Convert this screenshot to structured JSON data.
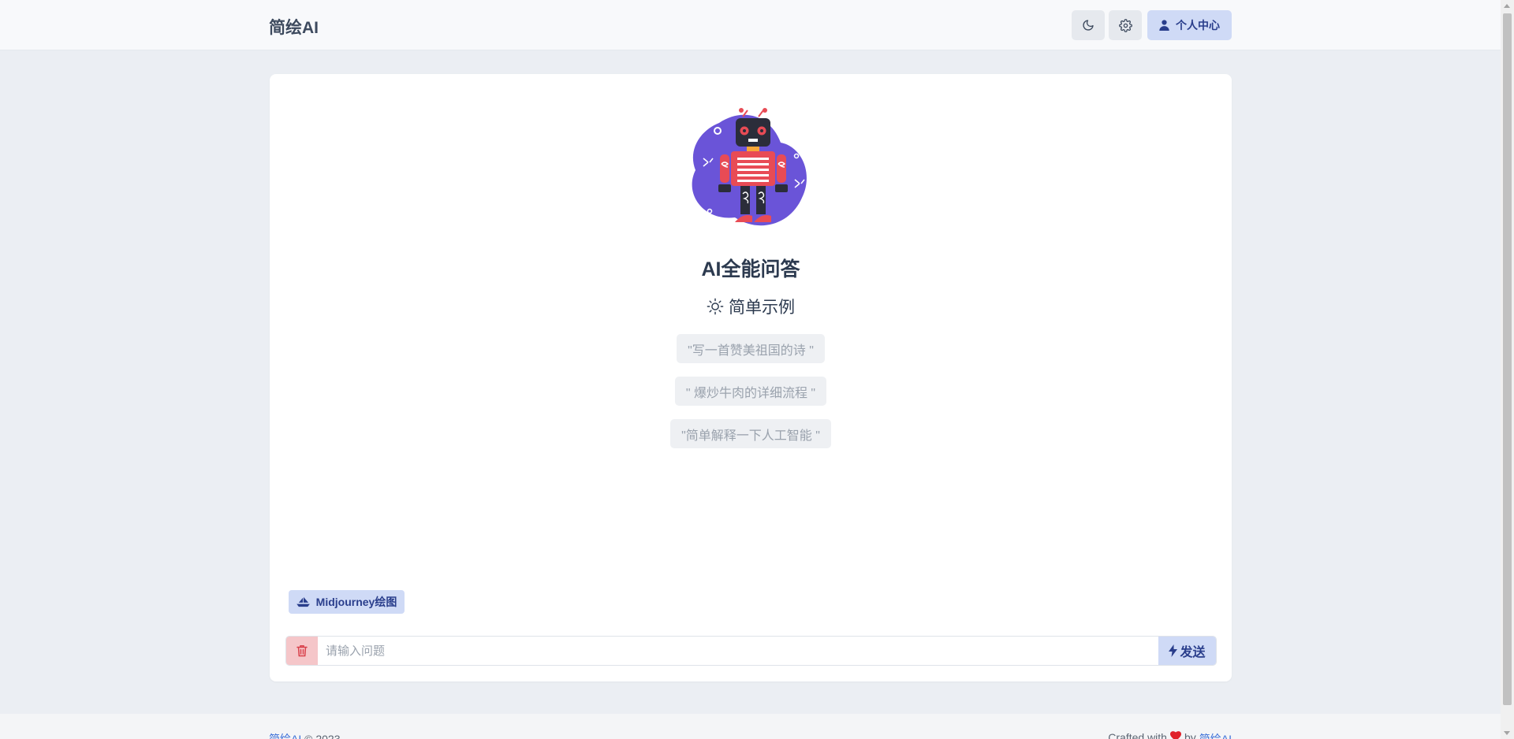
{
  "header": {
    "brand": "简绘AI",
    "user_center_label": "个人中心",
    "icons": {
      "theme": "moon-icon",
      "settings": "gear-icon",
      "user": "user-icon"
    }
  },
  "main": {
    "title": "AI全能问答",
    "examples_heading": "简单示例",
    "examples": [
      "\"写一首赞美祖国的诗 \"",
      "\" 爆炒牛肉的详细流程 \"",
      "\"简单解释一下人工智能 \""
    ],
    "midjourney_button": "Midjourney绘图",
    "input": {
      "placeholder": "请输入问题",
      "value": ""
    },
    "send_button": "发送"
  },
  "footer": {
    "brand_link": "简绘AI",
    "copyright": "© 2023",
    "crafted_with": "Crafted with",
    "by": "by",
    "author_link": "简绘AI"
  },
  "colors": {
    "accent_bg": "#cfdaf6",
    "accent_text": "#2a3e8c",
    "danger_bg": "#f5c6c9",
    "danger_icon": "#d9414b",
    "page_bg": "#ebeef3",
    "robot_blob": "#6a54d8",
    "heart": "#e0212b"
  }
}
